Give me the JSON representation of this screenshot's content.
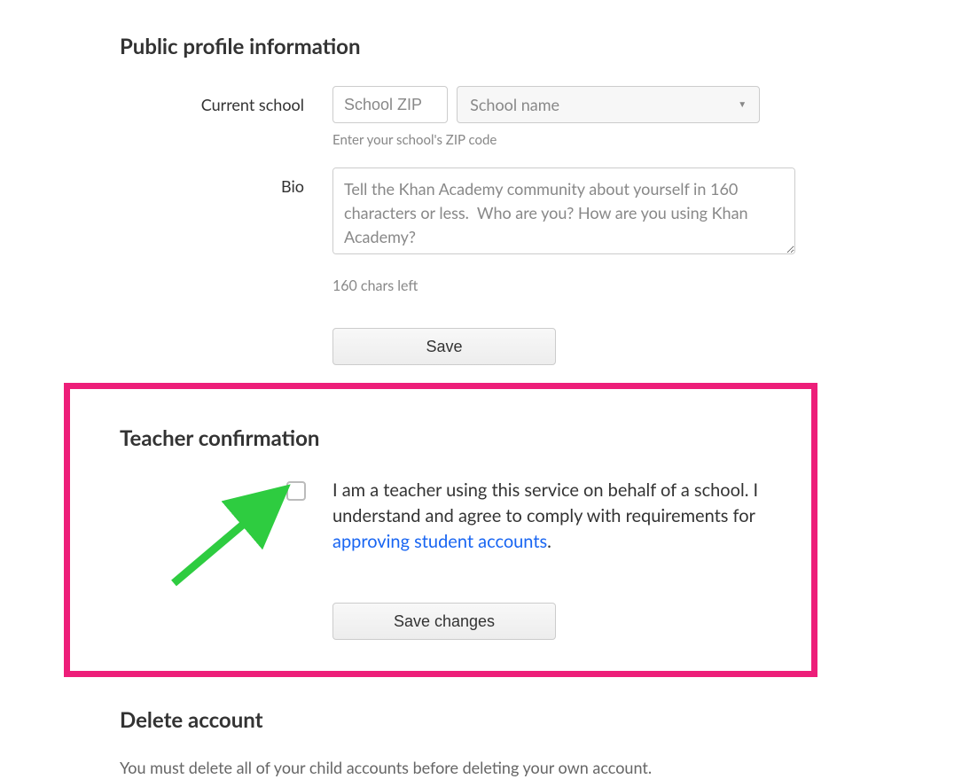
{
  "profile": {
    "heading": "Public profile information",
    "school_label": "Current school",
    "school_zip_placeholder": "School ZIP",
    "school_name_placeholder": "School name",
    "school_helper": "Enter your school's ZIP code",
    "bio_label": "Bio",
    "bio_placeholder": "Tell the Khan Academy community about yourself in 160 characters or less.  Who are you? How are you using Khan Academy?",
    "chars_left": "160 chars left",
    "save_label": "Save"
  },
  "teacher": {
    "heading": "Teacher confirmation",
    "text_part1": "I am a teacher using this service on behalf of a school. I understand and agree to comply with requirements for ",
    "link_text": "approving student accounts",
    "text_part2": ".",
    "save_label": "Save changes"
  },
  "delete": {
    "heading": "Delete account",
    "text": "You must delete all of your child accounts before deleting your own account."
  },
  "annotation": {
    "highlight_color": "#ed1e79",
    "arrow_color": "#2ecc40"
  }
}
